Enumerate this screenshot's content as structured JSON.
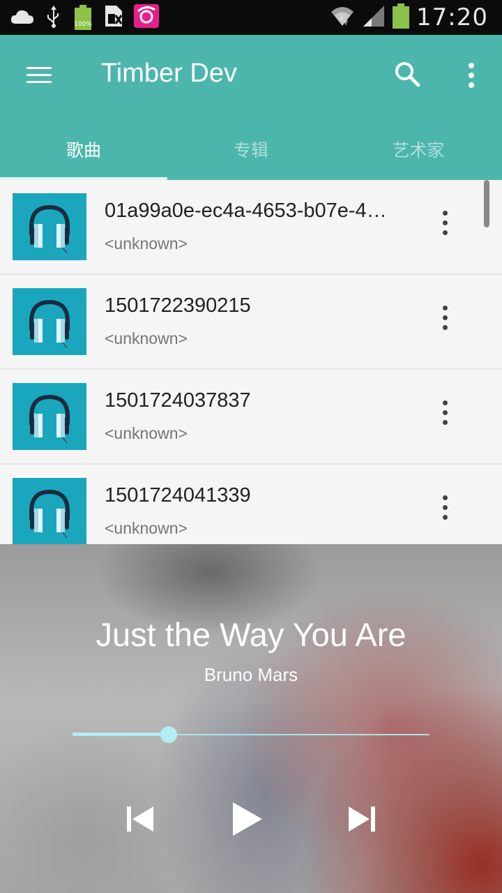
{
  "status_bar": {
    "time": "17:20",
    "battery_percent": "100%",
    "icons": [
      "weather-cloud-icon",
      "usb-icon",
      "battery-full-icon",
      "sim-card-icon",
      "app-notification-icon",
      "wifi-icon",
      "signal-icon",
      "battery-icon"
    ]
  },
  "app_bar": {
    "title": "Timber Dev",
    "color": "#4db6ac",
    "menu_icon": "hamburger-menu-icon",
    "search_icon": "search-icon",
    "overflow_icon": "more-vert-icon"
  },
  "tabs": [
    {
      "label": "歌曲",
      "active": true
    },
    {
      "label": "专辑",
      "active": false
    },
    {
      "label": "艺术家",
      "active": false
    }
  ],
  "songs": [
    {
      "title": "01a99a0e-ec4a-4653-b07e-4…",
      "artist": "<unknown>",
      "art_icon": "headphones-icon"
    },
    {
      "title": "1501722390215",
      "artist": "<unknown>",
      "art_icon": "headphones-icon"
    },
    {
      "title": "1501724037837",
      "artist": "<unknown>",
      "art_icon": "headphones-icon"
    },
    {
      "title": "1501724041339",
      "artist": "<unknown>",
      "art_icon": "headphones-icon"
    }
  ],
  "now_playing": {
    "title": "Just the Way You Are",
    "artist": "Bruno Mars",
    "progress": 0.27,
    "controls": [
      "skip-previous-icon",
      "play-icon",
      "skip-next-icon"
    ]
  }
}
